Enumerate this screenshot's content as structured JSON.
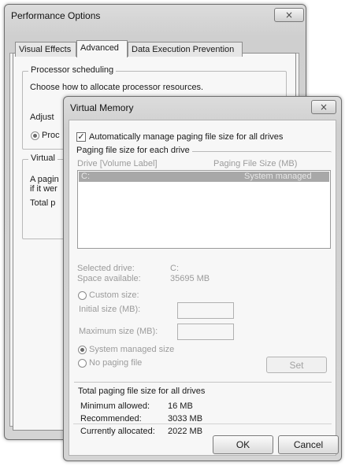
{
  "perf_window": {
    "title": "Performance Options",
    "close_label": "×",
    "tabs": [
      {
        "label": "Visual Effects"
      },
      {
        "label": "Advanced"
      },
      {
        "label": "Data Execution Prevention"
      }
    ],
    "processor_group": {
      "title": "Processor scheduling",
      "description": "Choose how to allocate processor resources.",
      "adjust_label": "Adjust",
      "programs_label": "Proc"
    },
    "virtual_group": {
      "title": "Virtual",
      "line1": "A pagin",
      "line2": "if it wer",
      "total_label": "Total p"
    }
  },
  "vm_dialog": {
    "title": "Virtual Memory",
    "close_label": "×",
    "auto_manage": {
      "label": "Automatically manage paging file size for all drives",
      "checked": true
    },
    "per_drive": {
      "title": "Paging file size for each drive",
      "col_drive": "Drive  [Volume Label]",
      "col_size": "Paging File Size (MB)",
      "rows": [
        {
          "drive": "C:",
          "size": "System managed"
        }
      ],
      "selected_drive_label": "Selected drive:",
      "selected_drive_value": "C:",
      "space_available_label": "Space available:",
      "space_available_value": "35695 MB",
      "custom_size_label": "Custom size:",
      "initial_size_label": "Initial size (MB):",
      "maximum_size_label": "Maximum size (MB):",
      "system_managed_label": "System managed size",
      "no_paging_label": "No paging file",
      "set_label": "Set"
    },
    "totals": {
      "title": "Total paging file size for all drives",
      "min_label": "Minimum allowed:",
      "min_value": "16 MB",
      "rec_label": "Recommended:",
      "rec_value": "3033 MB",
      "cur_label": "Currently allocated:",
      "cur_value": "2022 MB"
    },
    "ok_label": "OK",
    "cancel_label": "Cancel"
  }
}
